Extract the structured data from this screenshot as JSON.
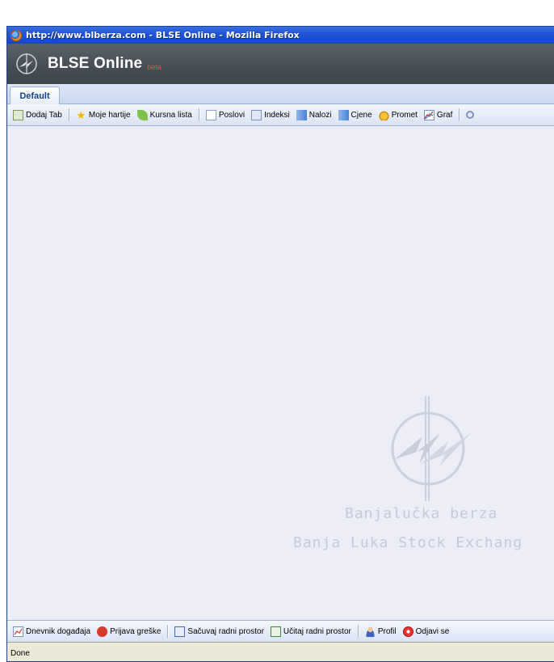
{
  "window": {
    "title": "http://www.blberza.com - BLSE Online - Mozilla Firefox"
  },
  "app": {
    "title": "BLSE Online",
    "badge": "beta"
  },
  "tabs": [
    {
      "label": "Default"
    }
  ],
  "toolbar_top": {
    "items": [
      {
        "label": "Dodaj Tab",
        "icon": "add-tab-icon"
      },
      {
        "label": "Moje hartije",
        "icon": "star-icon"
      },
      {
        "label": "Kursna lista",
        "icon": "leaf-icon"
      },
      {
        "label": "Poslovi",
        "icon": "document-icon"
      },
      {
        "label": "Indeksi",
        "icon": "index-icon"
      },
      {
        "label": "Nalozi",
        "icon": "orders-icon"
      },
      {
        "label": "Cjene",
        "icon": "prices-icon"
      },
      {
        "label": "Promet",
        "icon": "coins-icon"
      },
      {
        "label": "Graf",
        "icon": "graph-icon"
      }
    ]
  },
  "watermark": {
    "line1": "Banjalučka berza",
    "line2": "Banja Luka Stock Exchang"
  },
  "toolbar_bottom": {
    "items": [
      {
        "label": "Dnevnik događaja",
        "icon": "event-log-icon"
      },
      {
        "label": "Prijava greške",
        "icon": "bug-icon"
      },
      {
        "label": "Sačuvaj radni prostor",
        "icon": "save-workspace-icon"
      },
      {
        "label": "Učitaj radni prostor",
        "icon": "load-workspace-icon"
      },
      {
        "label": "Profil",
        "icon": "user-icon"
      },
      {
        "label": "Odjavi se",
        "icon": "logout-icon"
      }
    ]
  },
  "status": {
    "text": "Done"
  },
  "colors": {
    "titlebar": "#1f55d8",
    "header": "#474d55",
    "toolbar": "#dbe4f4",
    "beta": "#e8504a",
    "watermark": "#c7cad8"
  }
}
